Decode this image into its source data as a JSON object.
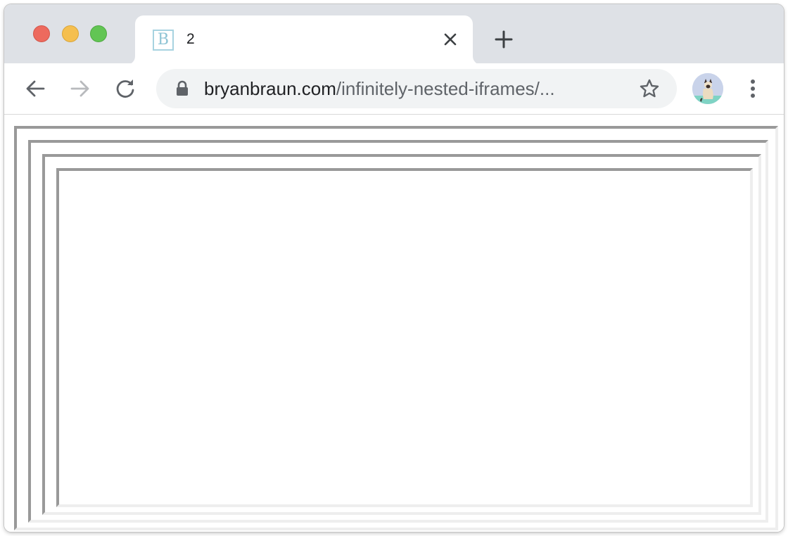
{
  "browser": {
    "tab": {
      "favicon_letter": "B",
      "title": "2"
    },
    "address_bar": {
      "url_host": "bryanbraun.com",
      "url_path": "/infinitely-nested-iframes/..."
    }
  },
  "colors": {
    "tab_strip_bg": "#dee1e6",
    "omnibox_bg": "#f1f3f4",
    "frame_dark": "#999999",
    "frame_light": "#eeeeee",
    "favicon_border": "#a7d3e0"
  },
  "icons": [
    "close-red",
    "minimize-yellow",
    "maximize-green",
    "close-icon",
    "plus-icon",
    "back-arrow-icon",
    "forward-arrow-icon",
    "reload-icon",
    "lock-icon",
    "star-icon",
    "avatar",
    "kebab-menu-icon"
  ],
  "content": {
    "nested_frame_count": 4
  }
}
